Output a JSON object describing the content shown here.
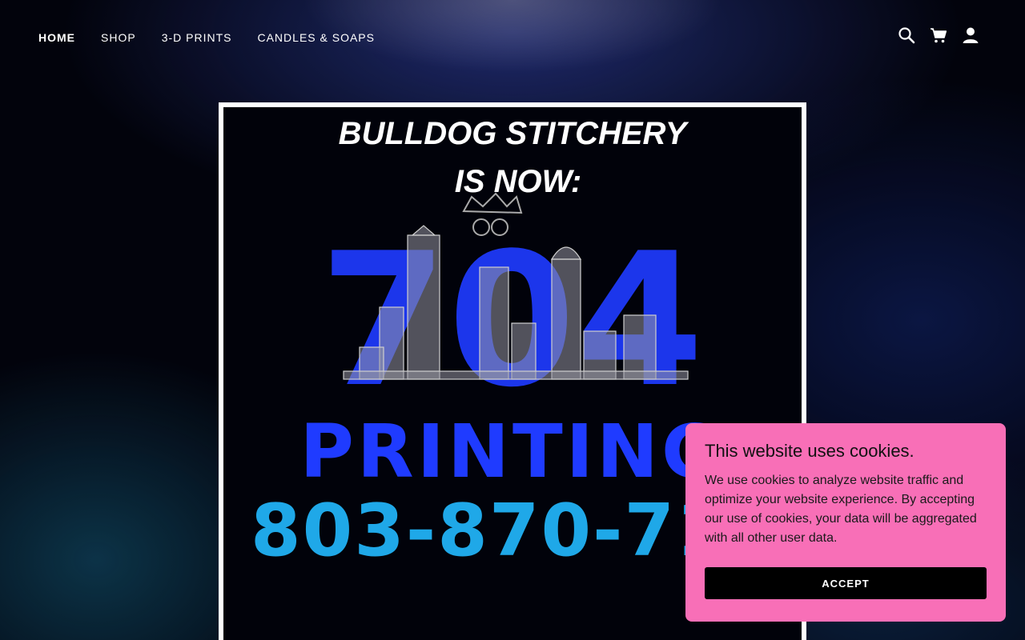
{
  "nav": {
    "items": [
      {
        "label": "HOME",
        "active": true
      },
      {
        "label": "SHOP",
        "active": false
      },
      {
        "label": "3-D PRINTS",
        "active": false
      },
      {
        "label": "CANDLES & SOAPS",
        "active": false
      }
    ],
    "icons": [
      "search-icon",
      "cart-icon",
      "account-icon"
    ]
  },
  "hero": {
    "line1": "BULLDOG STITCHERY",
    "line2": "IS NOW:",
    "big_number": "704",
    "word": "PRINTING",
    "phone": "803-870-71",
    "colors": {
      "blue": "#1f3bff",
      "cyan": "#1fa8e8",
      "white": "#ffffff"
    }
  },
  "cookie": {
    "title": "This website uses cookies.",
    "body": "We use cookies to analyze website traffic and optimize your website experience. By accepting our use of cookies, your data will be aggregated with all other user data.",
    "accept_label": "ACCEPT",
    "background": "#f86fb7"
  }
}
